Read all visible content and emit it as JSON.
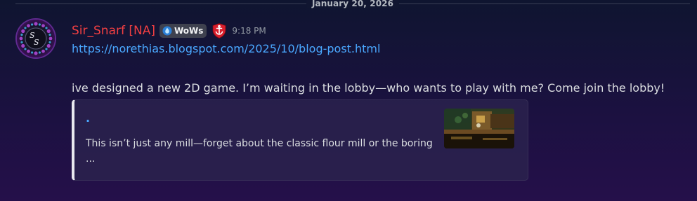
{
  "divider": {
    "date": "January 20, 2026"
  },
  "message": {
    "author": {
      "name": "Sir_Snarf [NA]",
      "name_color": "#f23f42",
      "tag": "WoWs",
      "avatar_text": "Sir Snarf"
    },
    "timestamp": "9:18 PM",
    "link": "https://norethias.blogspot.com/2025/10/blog-post.html",
    "text": "ive designed a new 2D game. I’m waiting in the lobby—who wants to play with me? Come join the lobby!",
    "embed": {
      "title": ".",
      "description": "This isn’t just any mill—forget about the classic flour mill or the boring ..."
    }
  },
  "colors": {
    "link": "#4aa8ff",
    "timestamp": "#949ba4",
    "embed_border": "#e9e9ef"
  },
  "icons": {
    "tag_icon": "water-drop-icon",
    "role_icon": "shield-anchor-icon"
  }
}
